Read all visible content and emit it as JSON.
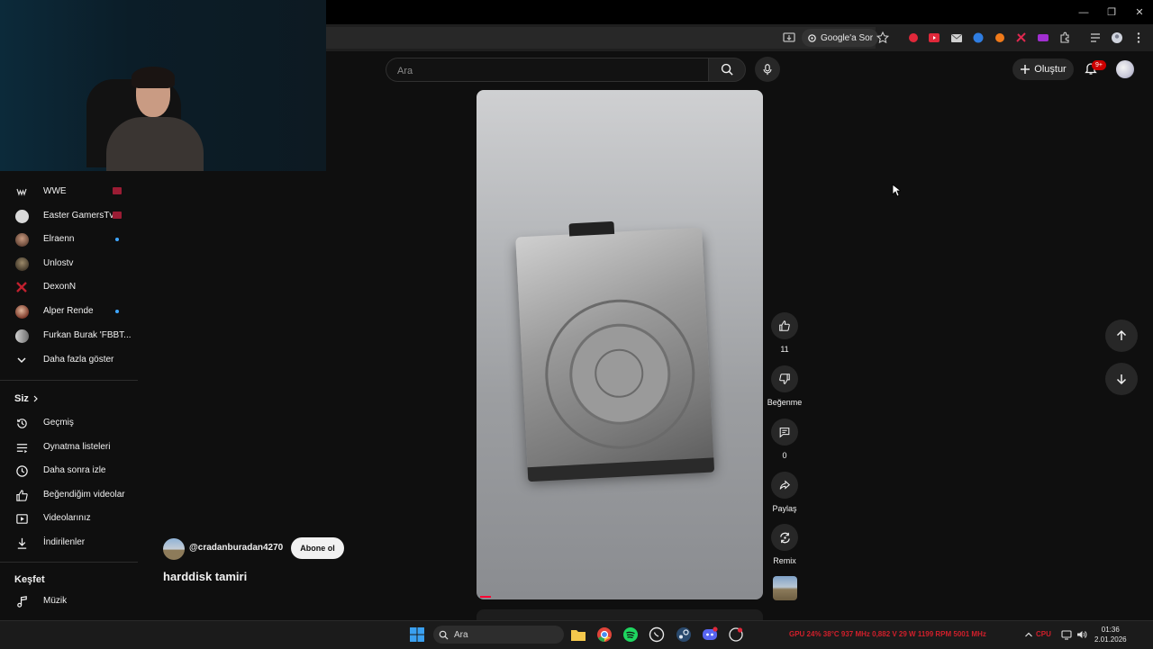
{
  "window": {
    "minimize": "—",
    "restore": "❐",
    "close": "✕"
  },
  "toolbar": {
    "google_chip_label": "Google'a Sor"
  },
  "search": {
    "placeholder": "Ara",
    "value": ""
  },
  "header": {
    "create_label": "Oluştur",
    "notification_count": "9+"
  },
  "sidebar": {
    "subscriptions": [
      {
        "name": "WWE",
        "indicator": "live"
      },
      {
        "name": "Easter GamersTv",
        "indicator": "live"
      },
      {
        "name": "Elraenn",
        "indicator": "new"
      },
      {
        "name": "Unlostv",
        "indicator": "none"
      },
      {
        "name": "DexonN",
        "indicator": "none"
      },
      {
        "name": "Alper Rende",
        "indicator": "new"
      },
      {
        "name": "Furkan Burak 'FBBT...",
        "indicator": "none"
      }
    ],
    "show_more_label": "Daha fazla göster",
    "you_heading": "Siz",
    "you_items": [
      {
        "label": "Geçmiş",
        "icon": "history-icon"
      },
      {
        "label": "Oynatma listeleri",
        "icon": "playlists-icon"
      },
      {
        "label": "Daha sonra izle",
        "icon": "watch-later-icon"
      },
      {
        "label": "Beğendiğim videolar",
        "icon": "like-icon"
      },
      {
        "label": "Videolarınız",
        "icon": "your-videos-icon"
      },
      {
        "label": "İndirilenler",
        "icon": "download-icon"
      }
    ],
    "explore_heading": "Keşfet",
    "explore_items": [
      {
        "label": "Müzik",
        "icon": "music-icon"
      }
    ]
  },
  "short": {
    "channel_handle": "@cradanburadan4270",
    "subscribe_label": "Abone ol",
    "title": "harddisk tamiri",
    "like_count": "11",
    "dislike_label": "Beğenme",
    "comment_count": "0",
    "share_label": "Paylaş",
    "remix_label": "Remix",
    "progress": 0.04
  },
  "taskbar": {
    "search_placeholder": "Ara",
    "gpu_stats": "GPU  24%  38°C  937 MHz  0,882 V  29 W  1199 RPM  5001 MHz",
    "cpu_prefix": "CPU",
    "time": "01:36",
    "date": "2.01.2026"
  },
  "colors": {
    "background": "#0f0f0f",
    "accent_red": "#ff0033",
    "badge_red": "#cc0000",
    "new_dot": "#3ea6ff",
    "stat_red": "#d21f2b"
  }
}
